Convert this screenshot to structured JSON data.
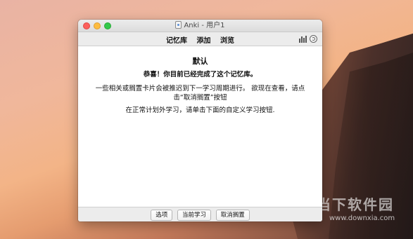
{
  "window": {
    "title": "Anki - 用户1",
    "toolbar": {
      "links": [
        "记忆库",
        "添加",
        "浏览"
      ]
    }
  },
  "main": {
    "heading": "默认",
    "congrats": "恭喜！你目前已经完成了这个记忆库。",
    "paragraph1": "一些相关或搁置卡片会被推迟到下一学习周期进行。 欲现在查看，请点击“取消搁置”按钮",
    "paragraph2": "在正常计划外学习，请单击下面的自定义学习按钮."
  },
  "footer": {
    "buttons": [
      "选项",
      "当前学习",
      "取消搁置"
    ]
  },
  "watermark": {
    "name": "当下软件园",
    "url": "www.downxia.com"
  },
  "icons": {
    "app": "anki-app-icon",
    "stats": "bar-chart-icon",
    "sync": "sync-icon"
  },
  "colors": {
    "close": "#fc605c",
    "minimize": "#fdbc40",
    "zoom": "#34c84a"
  }
}
